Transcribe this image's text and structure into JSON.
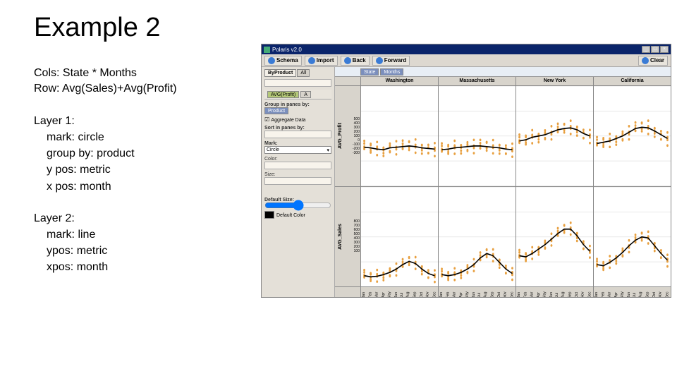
{
  "slide": {
    "title": "Example 2",
    "cols_line": "Cols: State * Months",
    "row_line": "Row: Avg(Sales)+Avg(Profit)",
    "layer1": {
      "header": "Layer 1:",
      "mark": "mark: circle",
      "group": "group by: product",
      "ypos": "y pos: metric",
      "xpos": "x pos: month"
    },
    "layer2": {
      "header": "Layer 2:",
      "mark": "mark: line",
      "ypos": "ypos: metric",
      "xpos": "xpos: month"
    }
  },
  "app": {
    "title": "Polaris v2.0",
    "toolbar": {
      "schema": "Schema",
      "import": "Import",
      "back": "Back",
      "forward": "Forward",
      "clear": "Clear"
    },
    "tabs": {
      "byproduct": "ByProduct",
      "all": "All"
    },
    "side": {
      "group_label": "Group in panes by:",
      "group_val": "Product",
      "agg": "Aggregate Data",
      "sort_label": "Sort in panes by:",
      "mark_label": "Mark:",
      "mark_val": "Circle",
      "color_label": "Color:",
      "size_label": "Size:",
      "defsize_label": "Default Size:",
      "defcolor_label": "Default Color"
    },
    "shelf": {
      "state": "State",
      "months": "Months",
      "avs_profit": "AVG(Profit)",
      "ind": "A"
    }
  },
  "chart_data": {
    "type": "scatter",
    "col_facets": [
      "Washington",
      "Massachusetts",
      "New York",
      "California"
    ],
    "row_facets": [
      "AVG_Profit",
      "AVG_Sales"
    ],
    "months": [
      "Jan",
      "Feb",
      "Mar",
      "Apr",
      "May",
      "Jun",
      "Jul",
      "Aug",
      "Sep",
      "Oct",
      "Nov",
      "Dec"
    ],
    "profit_ticks": [
      500,
      400,
      300,
      200,
      100,
      0,
      -100,
      -200,
      -300
    ],
    "sales_ticks": [
      800,
      700,
      600,
      500,
      400,
      300,
      200,
      100
    ],
    "ylim_profit": [
      -300,
      500
    ],
    "ylim_sales": [
      0,
      900
    ],
    "trend_profit": {
      "Washington": [
        10,
        5,
        -5,
        -10,
        5,
        10,
        15,
        20,
        15,
        5,
        0,
        -5
      ],
      "Massachusetts": [
        -10,
        -5,
        5,
        10,
        15,
        20,
        20,
        15,
        10,
        5,
        -5,
        -10
      ],
      "New York": [
        60,
        70,
        90,
        100,
        110,
        130,
        150,
        160,
        165,
        150,
        120,
        100
      ],
      "California": [
        40,
        50,
        60,
        80,
        100,
        130,
        160,
        170,
        165,
        140,
        110,
        80
      ]
    },
    "trend_sales": {
      "Washington": [
        100,
        90,
        95,
        110,
        130,
        160,
        200,
        230,
        210,
        160,
        120,
        100
      ],
      "Massachusetts": [
        110,
        100,
        110,
        130,
        160,
        200,
        260,
        300,
        280,
        220,
        160,
        120
      ],
      "New York": [
        280,
        270,
        300,
        340,
        380,
        430,
        480,
        520,
        520,
        460,
        380,
        320
      ],
      "California": [
        200,
        190,
        220,
        260,
        310,
        370,
        420,
        450,
        440,
        370,
        300,
        240
      ]
    },
    "scatter_spread": 60
  }
}
